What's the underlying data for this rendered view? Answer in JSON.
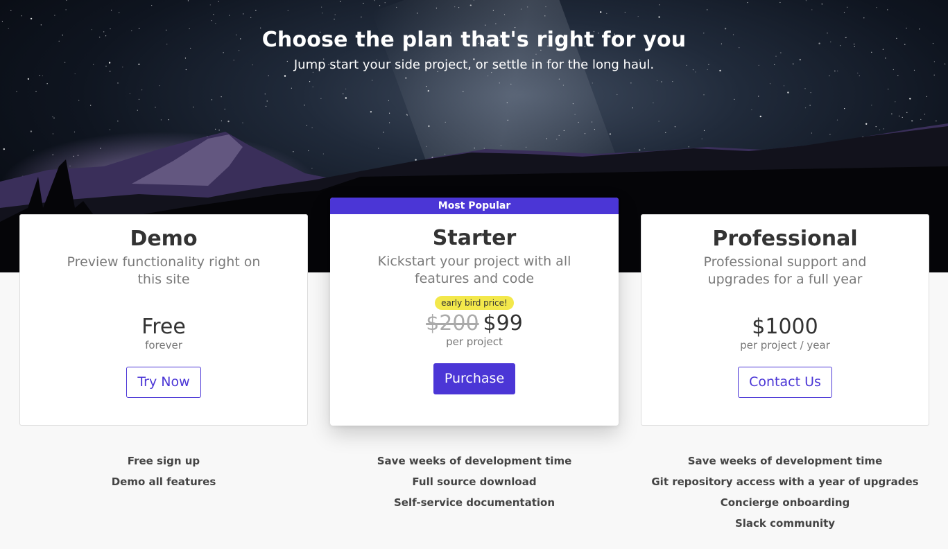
{
  "hero": {
    "title": "Choose the plan that's right for you",
    "subtitle": "Jump start your side project, or settle in for the long haul."
  },
  "colors": {
    "accent": "#4b36d6",
    "badge": "#f3e84b",
    "page_bg": "#f8f8f8"
  },
  "plans": [
    {
      "name": "Demo",
      "description_lines": [
        "Preview functionality right on",
        "this site"
      ],
      "price": "Free",
      "price_unit": "forever",
      "button": "Try Now",
      "features": [
        "Free sign up",
        "Demo all features"
      ]
    },
    {
      "ribbon": "Most Popular",
      "name": "Starter",
      "description_lines": [
        "Kickstart your project with all",
        "features and code"
      ],
      "badge": "early bird price!",
      "old_price": "$200",
      "price": "$99",
      "price_unit": "per project",
      "button": "Purchase",
      "features": [
        "Save weeks of development time",
        "Full source download",
        "Self-service documentation"
      ]
    },
    {
      "name": "Professional",
      "description_lines": [
        "Professional support and",
        "upgrades for a full year"
      ],
      "price": "$1000",
      "price_unit": "per project / year",
      "button": "Contact Us",
      "features": [
        "Save weeks of development time",
        "Git repository access with a year of upgrades",
        "Concierge onboarding",
        "Slack community"
      ]
    }
  ]
}
